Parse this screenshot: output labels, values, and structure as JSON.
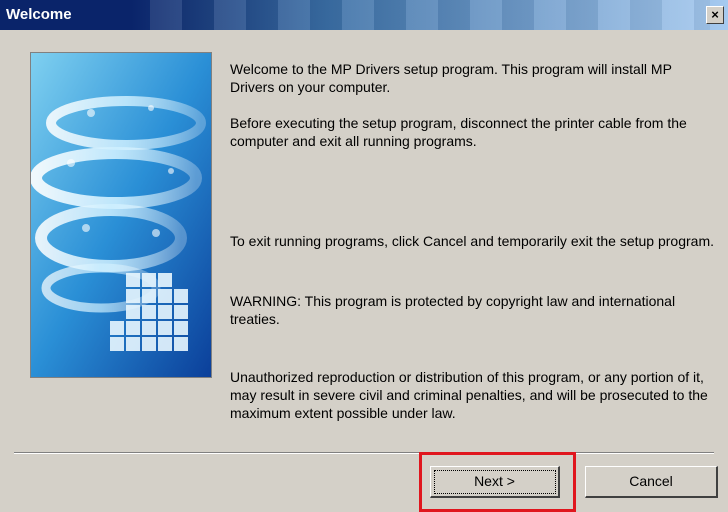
{
  "window": {
    "title": "Welcome",
    "close_label": "×"
  },
  "content": {
    "paragraphs": [
      "Welcome to the MP Drivers setup program. This program will install MP Drivers on your computer.",
      "Before executing the setup program, disconnect the printer cable from the computer and exit all running programs.",
      "To exit running programs, click Cancel and temporarily exit the setup program.",
      "WARNING: This program is protected by copyright law and international treaties.",
      "Unauthorized reproduction or distribution of this program, or any portion of it, may result in severe civil and criminal penalties, and will be prosecuted to the maximum extent possible under law."
    ]
  },
  "buttons": {
    "next_label": "Next >",
    "cancel_label": "Cancel"
  },
  "colors": {
    "title_bar": "#0a246a",
    "dialog_face": "#d4d0c8",
    "highlight_box": "#e0161e"
  },
  "icons": {
    "artwork": "setup-banner-image"
  }
}
